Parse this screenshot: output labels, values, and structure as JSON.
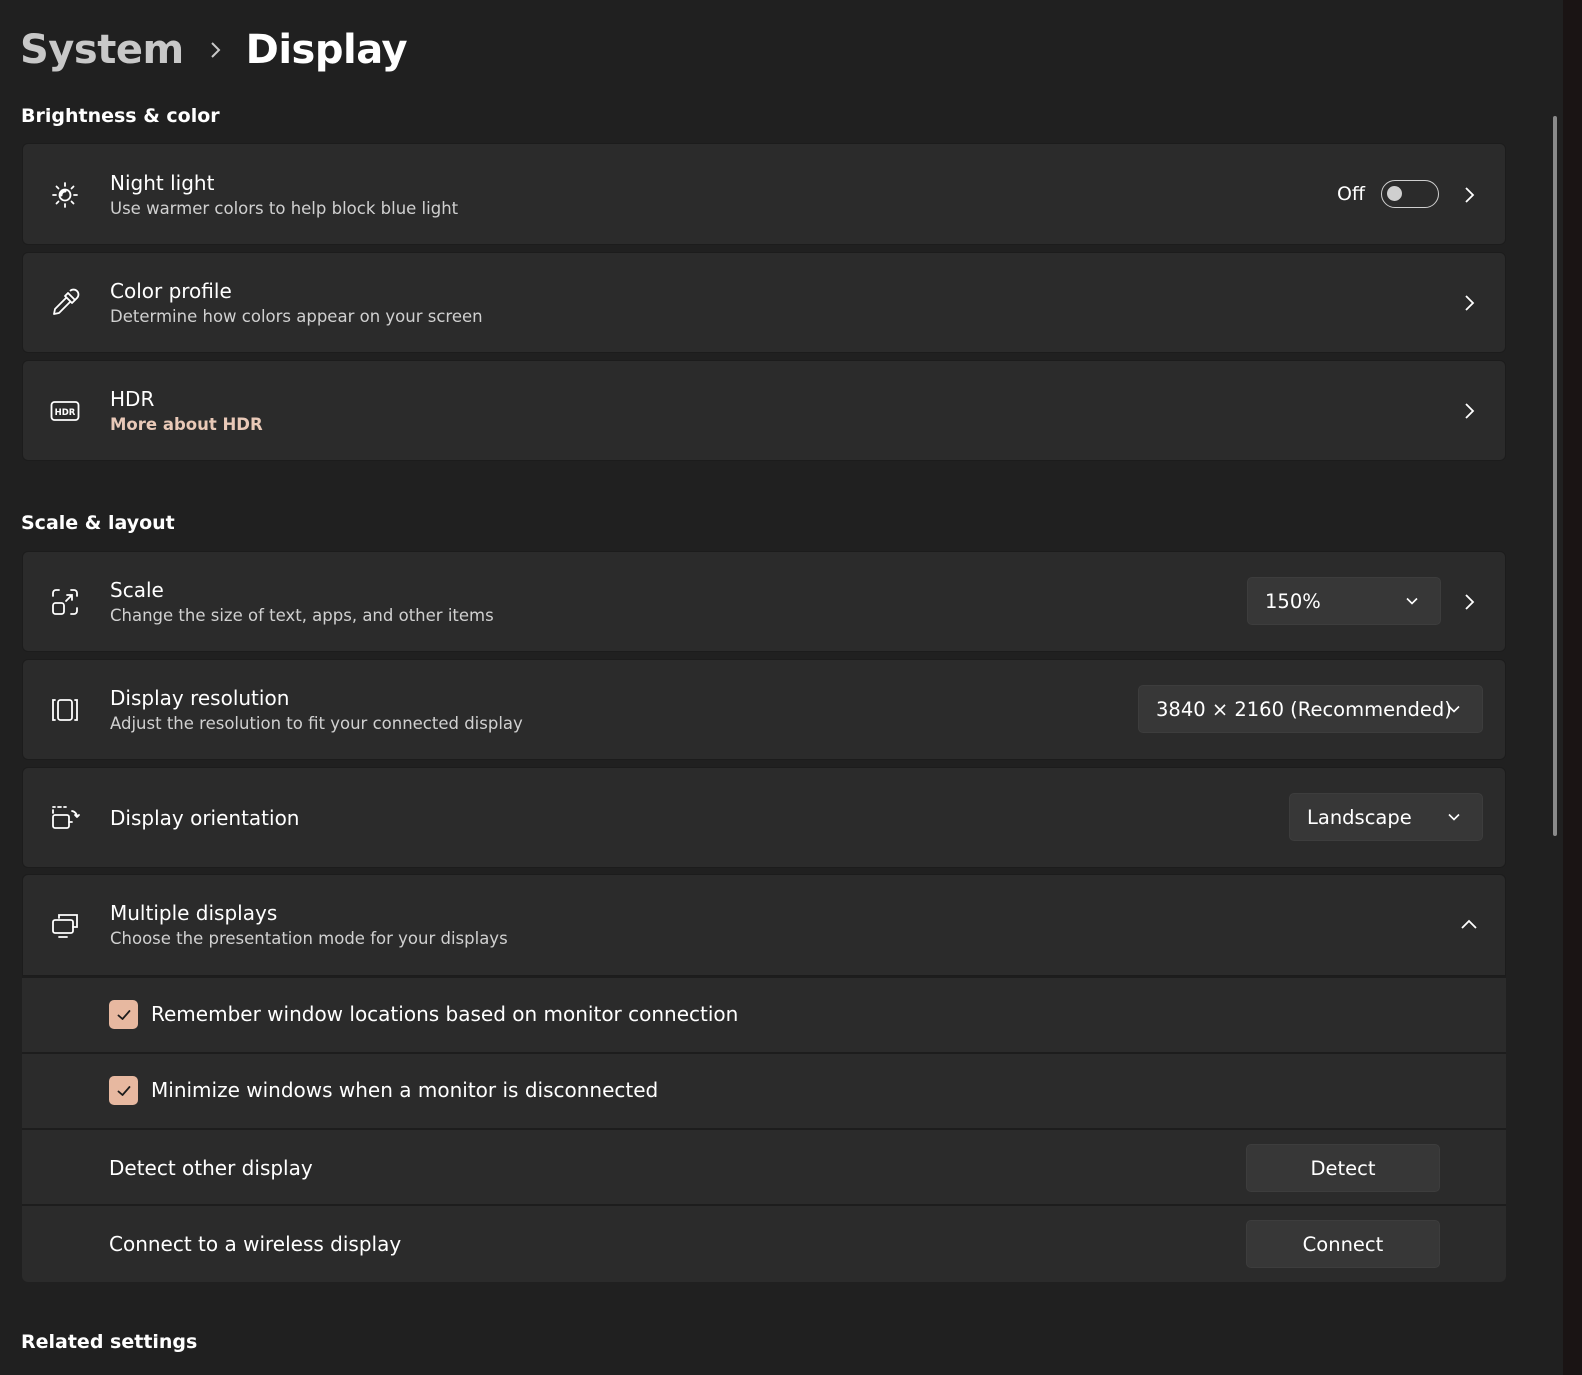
{
  "breadcrumb": {
    "parent": "System",
    "current": "Display"
  },
  "sections": {
    "brightness": "Brightness & color",
    "scale": "Scale & layout",
    "related": "Related settings"
  },
  "night_light": {
    "title": "Night light",
    "subtitle": "Use warmer colors to help block blue light",
    "state_label": "Off",
    "icon": "brightness-icon"
  },
  "color_profile": {
    "title": "Color profile",
    "subtitle": "Determine how colors appear on your screen",
    "icon": "eyedropper-icon"
  },
  "hdr": {
    "title": "HDR",
    "subtitle": "More about HDR",
    "icon": "hdr-icon"
  },
  "scale": {
    "title": "Scale",
    "subtitle": "Change the size of text, apps, and other items",
    "value": "150%",
    "icon": "scale-icon"
  },
  "resolution": {
    "title": "Display resolution",
    "subtitle": "Adjust the resolution to fit your connected display",
    "value": "3840 × 2160 (Recommended)",
    "icon": "resolution-icon"
  },
  "orientation": {
    "title": "Display orientation",
    "value": "Landscape",
    "icon": "orientation-icon"
  },
  "multiple_displays": {
    "title": "Multiple displays",
    "subtitle": "Choose the presentation mode for your displays",
    "icon": "multiple-displays-icon",
    "remember_label": "Remember window locations based on monitor connection",
    "minimize_label": "Minimize windows when a monitor is disconnected",
    "detect_label": "Detect other display",
    "detect_button": "Detect",
    "connect_label": "Connect to a wireless display",
    "connect_button": "Connect"
  },
  "colors": {
    "background": "#202020",
    "card": "#2b2b2b",
    "accent": "#e7b8a0"
  }
}
